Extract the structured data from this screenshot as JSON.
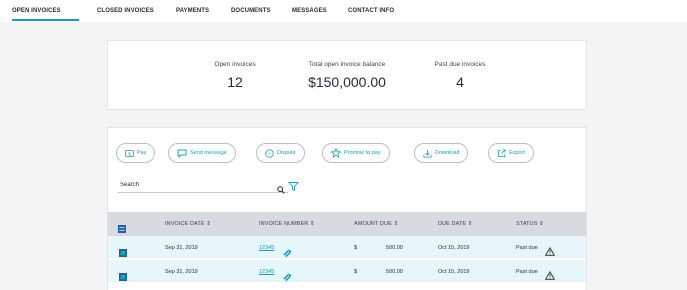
{
  "tabs": [
    {
      "label": "OPEN INVOICES",
      "active": true
    },
    {
      "label": "CLOSED INVOICES",
      "active": false
    },
    {
      "label": "PAYMENTS",
      "active": false
    },
    {
      "label": "DOCUMENTS",
      "active": false
    },
    {
      "label": "MESSAGES",
      "active": false
    },
    {
      "label": "CONTACT INFO",
      "active": false
    }
  ],
  "summary": {
    "open_invoices": {
      "label": "Open invoices",
      "value": "12"
    },
    "total_balance": {
      "label": "Total open invoice balance",
      "value": "$150,000.00"
    },
    "past_due": {
      "label": "Past due invoices",
      "value": "4"
    }
  },
  "actions": [
    {
      "label": "Pay",
      "icon": "dollar-icon"
    },
    {
      "label": "Send message",
      "icon": "message-icon"
    },
    {
      "label": "Dispute",
      "icon": "question-icon"
    },
    {
      "label": "Promise to pay",
      "icon": "star-icon"
    },
    {
      "label": "Download",
      "icon": "download-icon"
    },
    {
      "label": "Export",
      "icon": "export-icon"
    }
  ],
  "search": {
    "placeholder": "Search"
  },
  "table": {
    "columns": [
      "INVOICE DATE ⇕",
      "INVOICE NUMBER ⇕",
      "AMOUNT DUE ⇕",
      "DUE DATE ⇕",
      "STATUS ⇕"
    ],
    "rows": [
      {
        "invoice_date": "Sep 31, 2019",
        "invoice_number": "12345",
        "currency": "$",
        "amount": "500.00",
        "due_date": "Oct 15, 2019",
        "status": "Past due"
      },
      {
        "invoice_date": "Sep 31, 2019",
        "invoice_number": "12345",
        "currency": "$",
        "amount": "500.00",
        "due_date": "Oct 15, 2019",
        "status": "Past due"
      }
    ]
  },
  "colors": {
    "accent": "#1aa0b4",
    "row_bg": "#e7f6fa",
    "header_bg": "#d7dade"
  }
}
